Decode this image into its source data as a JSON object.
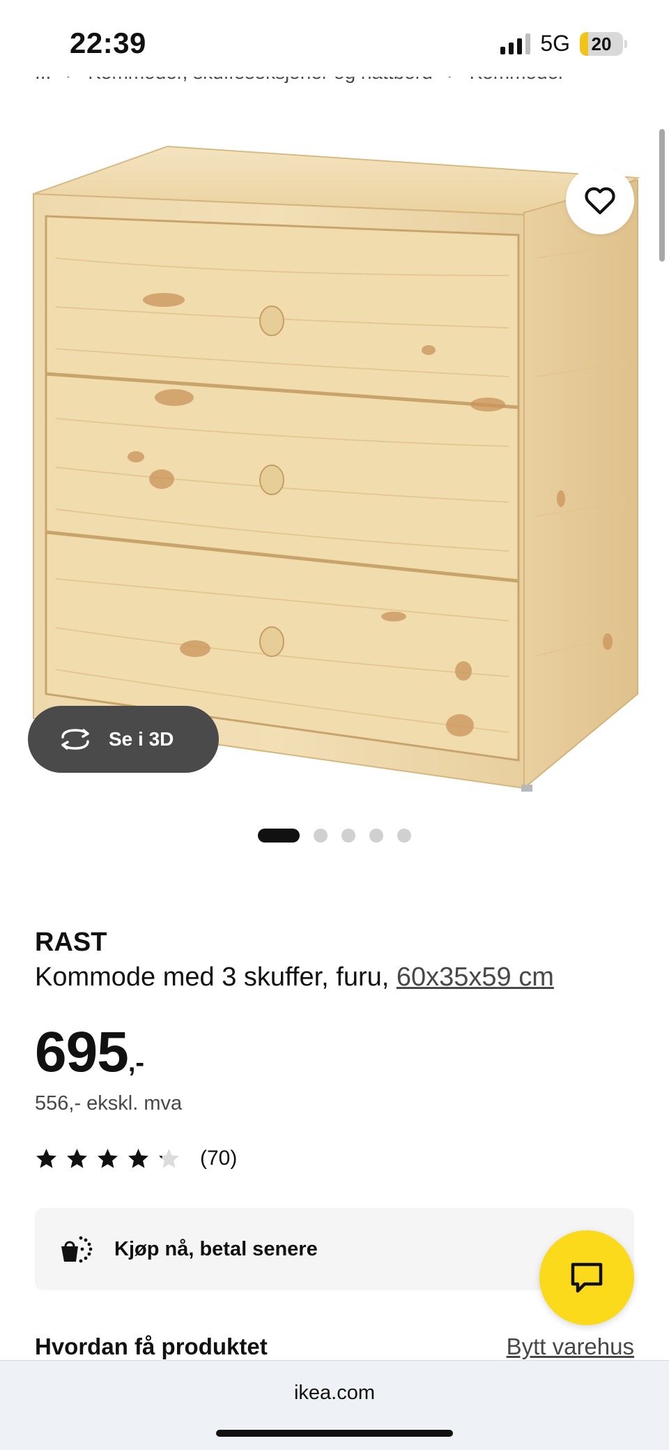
{
  "status_bar": {
    "time": "22:39",
    "network": "5G",
    "battery": "20",
    "battery_level": 0.2
  },
  "breadcrumb": {
    "items": [
      "...",
      "›",
      "Kommoder, skuffeseksjoner og nattbord",
      "›",
      "Kommoder"
    ]
  },
  "gallery": {
    "button_3d_label": "Se i 3D",
    "active_index": 0,
    "total": 5
  },
  "product": {
    "name": "RAST",
    "description": "Kommode med 3 skuffer, furu, ",
    "dimensions": "60x35x59 cm",
    "price_int": "695",
    "price_suffix": ",-",
    "price_ex_vat": "556,- ekskl. mva",
    "rating": 4.2,
    "rating_count": "(70)"
  },
  "pay_later": {
    "label": "Kjøp nå, betal senere"
  },
  "delivery": {
    "heading": "Hvordan få produktet",
    "change_store": "Bytt varehus"
  },
  "browser": {
    "url": "ikea.com"
  },
  "colors": {
    "chat_fab": "#fada1a",
    "battery": "#f2c318",
    "btn_3d": "#4a4a4a"
  }
}
